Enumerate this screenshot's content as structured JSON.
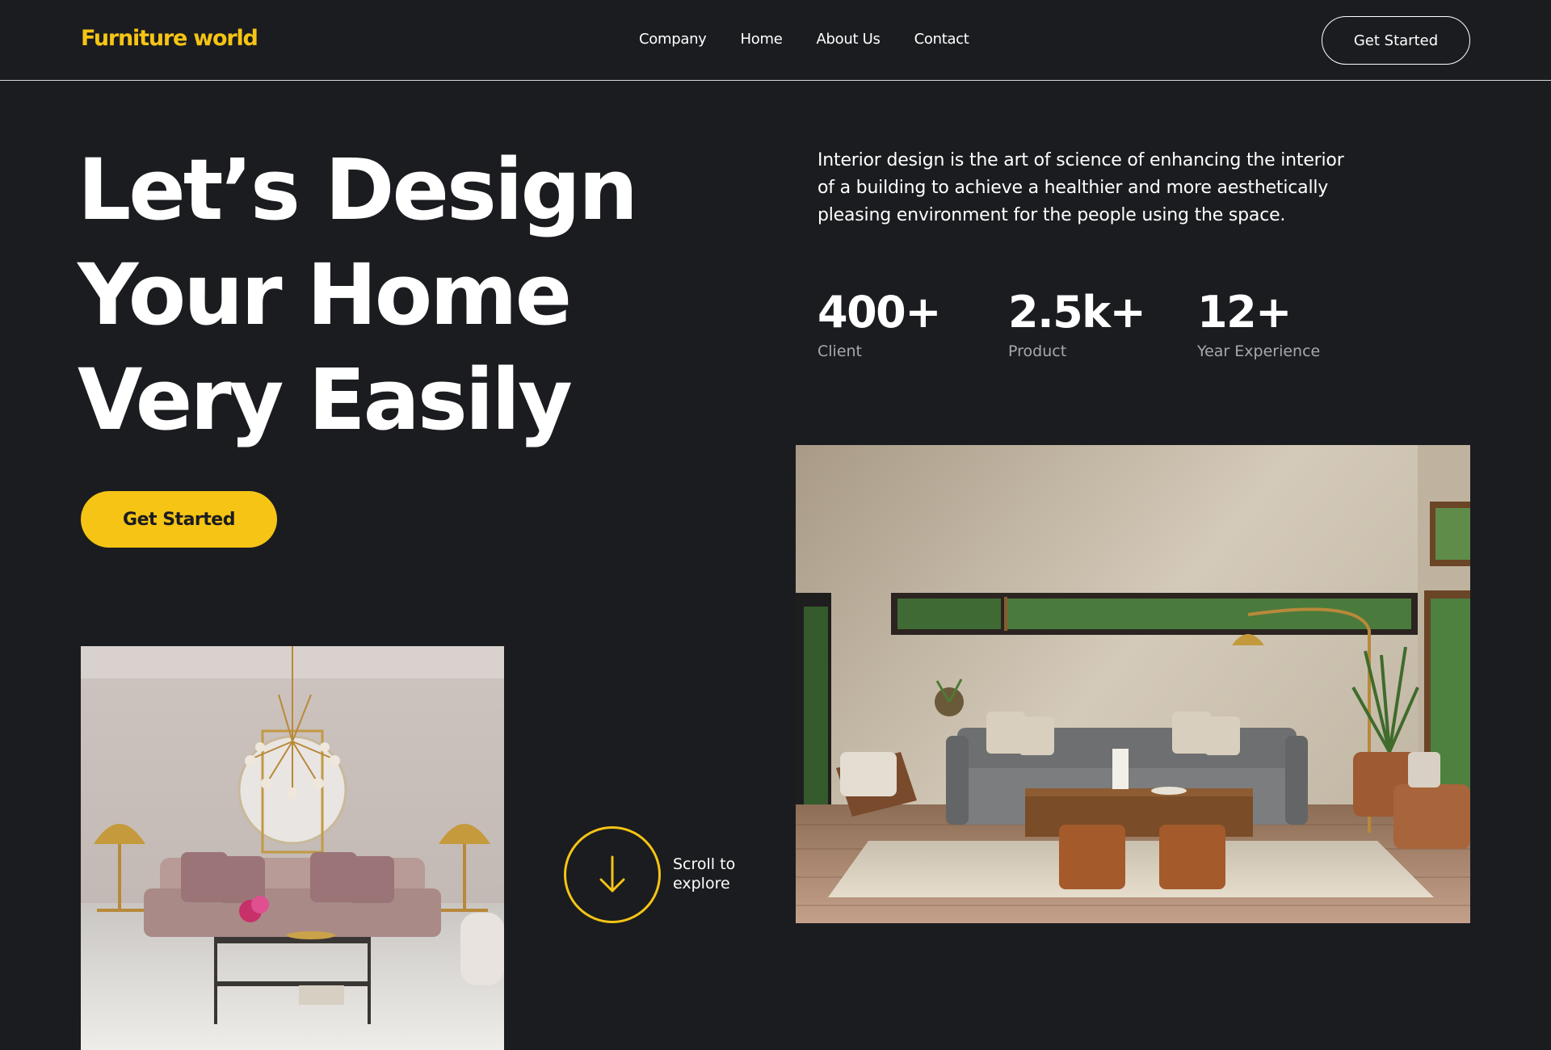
{
  "header": {
    "logo": "Furniture world",
    "nav": [
      "Company",
      "Home",
      "About Us",
      "Contact"
    ],
    "cta": "Get Started"
  },
  "hero": {
    "title_lines": [
      "Let’s Design",
      "Your Home",
      "Very Easily"
    ],
    "cta": "Get Started",
    "description": "Interior design is the art of science of enhancing the interior of a building to achieve a healthier and more aesthetically pleasing environment for the people using the space."
  },
  "stats": [
    {
      "value": "400+",
      "label": "Client"
    },
    {
      "value": "2.5k+",
      "label": "Product"
    },
    {
      "value": "12+",
      "label": "Year Experience"
    }
  ],
  "scroll": {
    "text": "Scroll to explore",
    "icon": "arrow-down-icon"
  },
  "colors": {
    "background": "#1b1c20",
    "accent": "#f5c414",
    "text": "#ffffff",
    "muted": "#a7a8ab"
  }
}
